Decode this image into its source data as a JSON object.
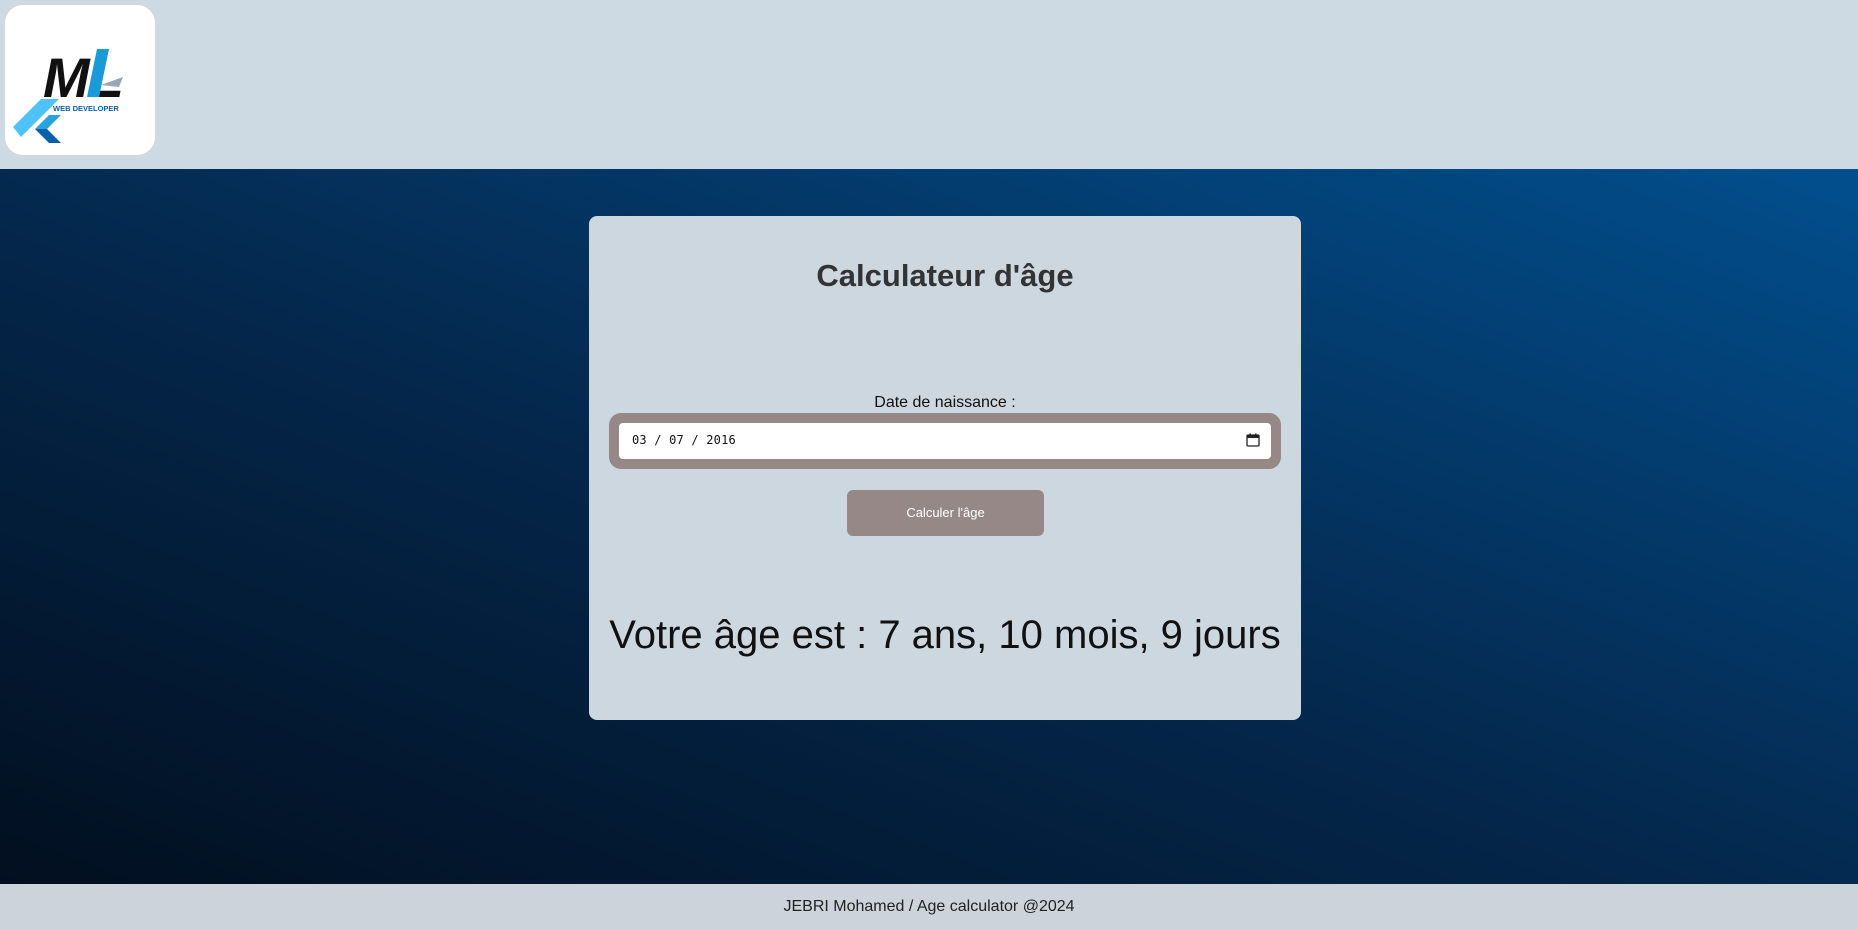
{
  "header": {
    "logo": {
      "text": "ML",
      "subtitle": "WEB DEVELOPER",
      "icon": "flutter-icon",
      "colors": {
        "black": "#111111",
        "blue": "#1a9ad6",
        "light_blue": "#4fc3f7",
        "dark_blue": "#0a5fa8"
      }
    }
  },
  "card": {
    "title": "Calculateur d'âge",
    "dob_label": "Date de naissance :",
    "date_input": {
      "value": "03 / 07 / 2016",
      "icon": "calendar-icon"
    },
    "calculate_button": "Calculer l'âge",
    "result": "Votre âge est : 7 ans, 10 mois, 9 jours"
  },
  "footer": {
    "text": "JEBRI Mohamed / Age calculator @2024"
  },
  "colors": {
    "header_bg": "#cdd9e3",
    "card_bg": "#cdd7e0",
    "accent_button": "#978888",
    "gradient_dark": "#020f1f",
    "gradient_light": "#024f8e"
  }
}
